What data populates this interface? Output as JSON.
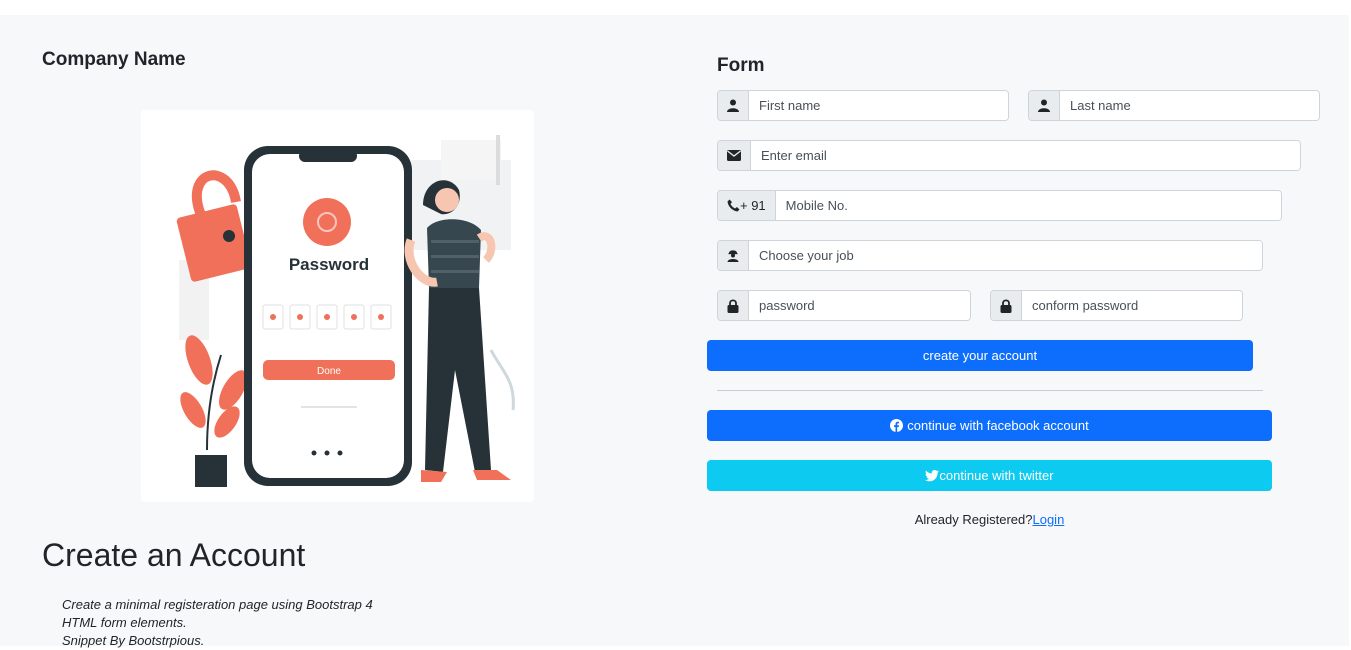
{
  "brand": {
    "company_name": "Company Name"
  },
  "illustration": {
    "screen_label": "Password",
    "button_label": "Done",
    "accent_color": "#f0705a",
    "dark_color": "#263238"
  },
  "intro": {
    "title": "Create an Account",
    "description_lines": [
      "Create a minimal registeration page using Bootstrap 4",
      "HTML form elements.",
      "Snippet By Bootstrpious."
    ]
  },
  "form": {
    "title": "Form",
    "first_name": {
      "placeholder": "First name",
      "icon": "user-icon"
    },
    "last_name": {
      "placeholder": "Last name",
      "icon": "user-icon"
    },
    "email": {
      "placeholder": "Enter email",
      "icon": "envelope-icon"
    },
    "mobile": {
      "prefix": "+ 91",
      "placeholder": "Mobile No.",
      "icon": "phone-icon"
    },
    "job": {
      "placeholder": "Choose your job",
      "icon": "worker-icon"
    },
    "password": {
      "placeholder": "password",
      "icon": "lock-icon"
    },
    "confirm_password": {
      "placeholder": "conform password",
      "icon": "lock-icon"
    },
    "submit_label": "create your account",
    "facebook_label": "continue with facebook account",
    "twitter_label": "continue with twitter",
    "already_text": "Already Registered?",
    "login_link": "Login"
  },
  "colors": {
    "primary": "#0d6efd",
    "info": "#0dcaf0",
    "background": "#f7f8fa"
  }
}
